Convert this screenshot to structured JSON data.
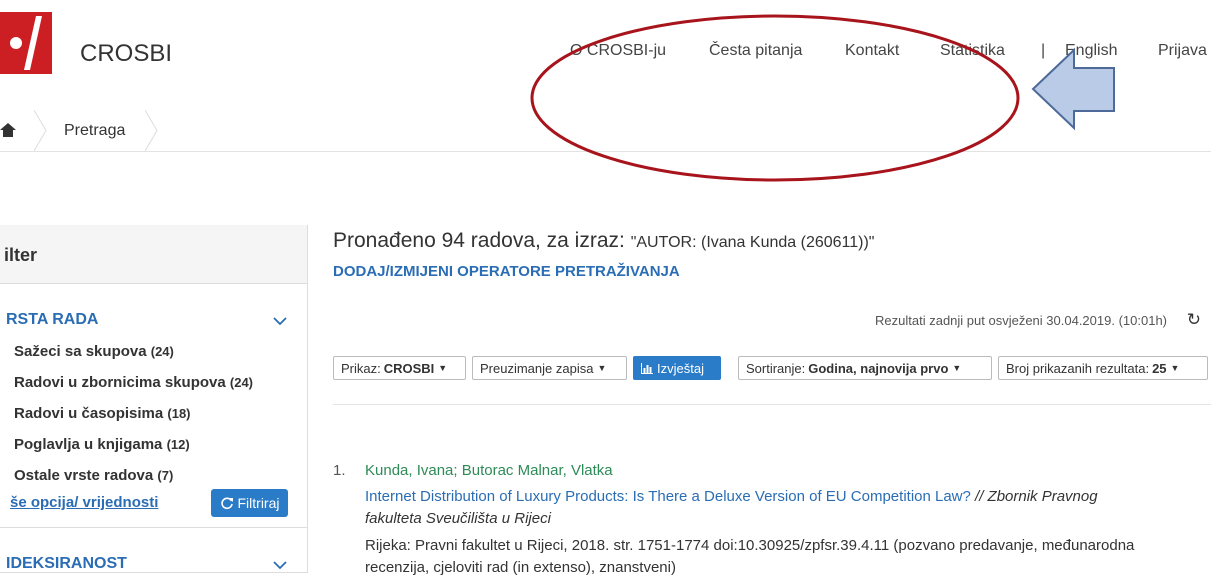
{
  "header": {
    "brand": "CROSBI",
    "nav": [
      {
        "label": "O CROSBI-ju"
      },
      {
        "label": "Česta pitanja"
      },
      {
        "label": "Kontakt"
      },
      {
        "label": "Statistika"
      },
      {
        "label": "|"
      },
      {
        "label": "English"
      },
      {
        "label": "Prijava"
      }
    ]
  },
  "breadcrumb": {
    "current": "Pretraga"
  },
  "sidebar": {
    "title": "ilter",
    "section1_title": "RSTA RADA",
    "items": [
      {
        "label": "Sažeci sa skupova",
        "count": "(24)"
      },
      {
        "label": "Radovi u zbornicima skupova",
        "count": "(24)"
      },
      {
        "label": "Radovi u časopisima",
        "count": "(18)"
      },
      {
        "label": "Poglavlja u knjigama",
        "count": "(12)"
      },
      {
        "label": "Ostale vrste radova",
        "count": "(7)"
      }
    ],
    "more_link": "še opcija/ vrijednosti",
    "filter_button": "Filtriraj",
    "section2_title": "IDEKSIRANOST"
  },
  "main": {
    "result_head": "Pronađeno 94 radova, za izraz:",
    "result_query": "\"AUTOR: (Ivana Kunda (260611))\"",
    "ops_link": "DODAJ/IZMIJENI OPERATORE PRETRAŽIVANJA",
    "refresh_text": "Rezultati zadnji put osvježeni 30.04.2019. (10:01h)",
    "toolbar": {
      "prikaz_label": "Prikaz:",
      "prikaz_value": "CROSBI",
      "preuzimanje": "Preuzimanje zapisa",
      "izvjestaj": "Izvještaj",
      "sort_label": "Sortiranje:",
      "sort_value": "Godina, najnovija prvo",
      "broj_label": "Broj prikazanih rezultata:",
      "broj_value": "25"
    },
    "result": {
      "num": "1.",
      "authors": "Kunda, Ivana; Butorac Malnar, Vlatka",
      "title": "Internet Distribution of Luxury Products: Is There a Deluxe Version of EU Competition Law?",
      "source": "// Zbornik Pravnog fakulteta Sveučilišta u Rijeci",
      "detail": "Rijeka: Pravni fakultet u Rijeci, 2018. str. 1751-1774 doi:10.30925/zpfsr.39.4.11 (pozvano predavanje, međunarodna recenzija, cjeloviti rad (in extenso), znanstveni)"
    }
  },
  "colors": {
    "brand_red": "#cc1f24",
    "link_blue": "#2a6db4",
    "author_green": "#2e8b57",
    "annotation_red": "#a8141c",
    "arrow_blue": "#b9cbe6"
  }
}
